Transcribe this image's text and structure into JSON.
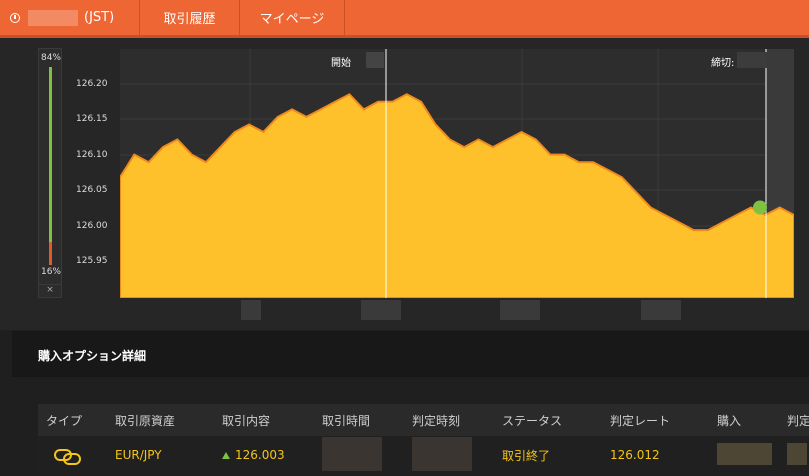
{
  "header": {
    "timezone_label": "(JST)",
    "tabs": [
      {
        "label": "取引履歴"
      },
      {
        "label": "マイページ"
      }
    ]
  },
  "gauge": {
    "top_label": "84%",
    "bottom_label": "16%",
    "close_label": "×",
    "up_fraction": 0.84,
    "down_fraction": 0.16
  },
  "chart_data": {
    "type": "area",
    "y_ticks": [
      "126.20",
      "126.15",
      "126.10",
      "126.05",
      "126.00",
      "125.95"
    ],
    "ylim": [
      125.9,
      126.23
    ],
    "start_label": "開始",
    "end_label": "締切:",
    "values": [
      126.06,
      126.09,
      126.08,
      126.1,
      126.11,
      126.09,
      126.08,
      126.1,
      126.12,
      126.13,
      126.12,
      126.14,
      126.15,
      126.14,
      126.15,
      126.16,
      126.17,
      126.15,
      126.16,
      126.16,
      126.17,
      126.16,
      126.13,
      126.11,
      126.1,
      126.11,
      126.1,
      126.11,
      126.12,
      126.11,
      126.09,
      126.09,
      126.08,
      126.08,
      126.07,
      126.06,
      126.04,
      126.02,
      126.01,
      126.0,
      125.99,
      125.99,
      126.0,
      126.01,
      126.02,
      126.01,
      126.02,
      126.01
    ],
    "marker_value": 126.02,
    "colors": {
      "fill": "#ffc12b",
      "stroke": "#f08a1c",
      "marker": "#7fc242"
    }
  },
  "detail": {
    "title": "購入オプション詳細",
    "columns": [
      "タイプ",
      "取引原資産",
      "取引内容",
      "取引時間",
      "判定時刻",
      "ステータス",
      "判定レート",
      "購入",
      "判定"
    ],
    "row": {
      "asset": "EUR/JPY",
      "content_value": "126.003",
      "status": "取引終了",
      "rate": "126.012"
    }
  }
}
